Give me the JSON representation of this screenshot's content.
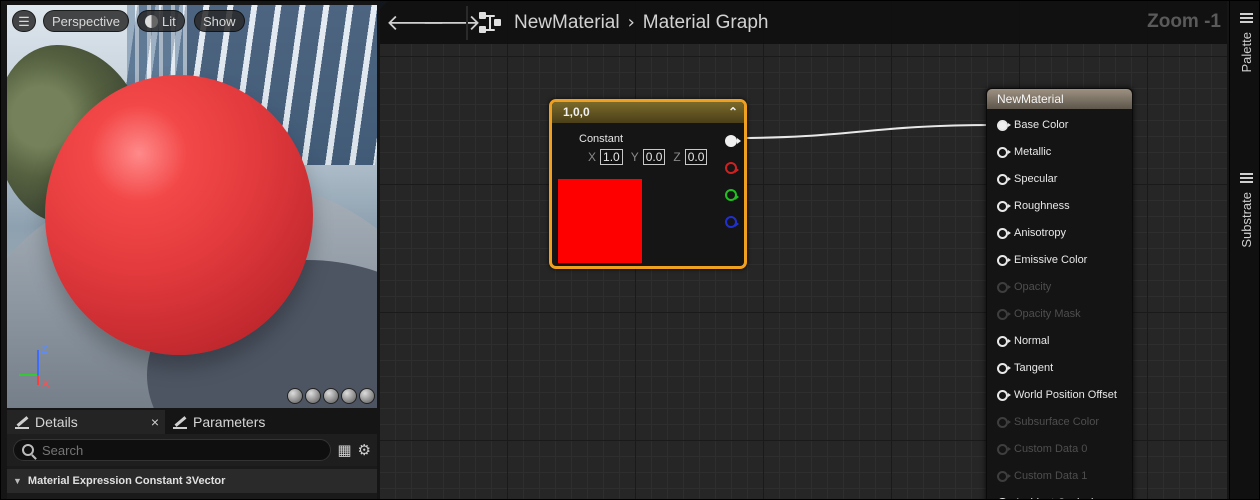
{
  "viewport": {
    "menu_icon": "hamburger-icon",
    "perspective_label": "Perspective",
    "lit_label": "Lit",
    "show_label": "Show",
    "axis": {
      "z": "Z",
      "x": "X"
    },
    "sphere_color": "#e23a3d"
  },
  "details": {
    "tab_details": "Details",
    "tab_close": "×",
    "tab_parameters": "Parameters",
    "search_placeholder": "Search",
    "section_title": "Material Expression Constant 3Vector"
  },
  "graph": {
    "breadcrumb_root": "NewMaterial",
    "breadcrumb_sep": "›",
    "breadcrumb_current": "Material Graph",
    "zoom": "Zoom -1",
    "constant_node": {
      "title": "1,0,0",
      "label": "Constant",
      "x_label": "X",
      "x_value": "1.0",
      "y_label": "Y",
      "y_value": "0.0",
      "z_label": "Z",
      "z_value": "0.0",
      "swatch_color": "#ff0000",
      "collapse_icon": "chevron-up-icon"
    },
    "material_node": {
      "title": "NewMaterial",
      "pins": [
        {
          "label": "Base Color",
          "connected": true,
          "enabled": true
        },
        {
          "label": "Metallic",
          "connected": false,
          "enabled": true
        },
        {
          "label": "Specular",
          "connected": false,
          "enabled": true
        },
        {
          "label": "Roughness",
          "connected": false,
          "enabled": true
        },
        {
          "label": "Anisotropy",
          "connected": false,
          "enabled": true
        },
        {
          "label": "Emissive Color",
          "connected": false,
          "enabled": true
        },
        {
          "label": "Opacity",
          "connected": false,
          "enabled": false
        },
        {
          "label": "Opacity Mask",
          "connected": false,
          "enabled": false
        },
        {
          "label": "Normal",
          "connected": false,
          "enabled": true
        },
        {
          "label": "Tangent",
          "connected": false,
          "enabled": true
        },
        {
          "label": "World Position Offset",
          "connected": false,
          "enabled": true
        },
        {
          "label": "Subsurface Color",
          "connected": false,
          "enabled": false
        },
        {
          "label": "Custom Data 0",
          "connected": false,
          "enabled": false
        },
        {
          "label": "Custom Data 1",
          "connected": false,
          "enabled": false
        },
        {
          "label": "Ambient Occlusion",
          "connected": false,
          "enabled": true
        }
      ]
    }
  },
  "rightbar": {
    "palette_label": "Palette",
    "substrate_label": "Substrate"
  },
  "colors": {
    "node_selected_border": "#f0a020",
    "pin_red": "#d02020",
    "pin_green": "#20c020",
    "pin_blue": "#2020d0"
  }
}
